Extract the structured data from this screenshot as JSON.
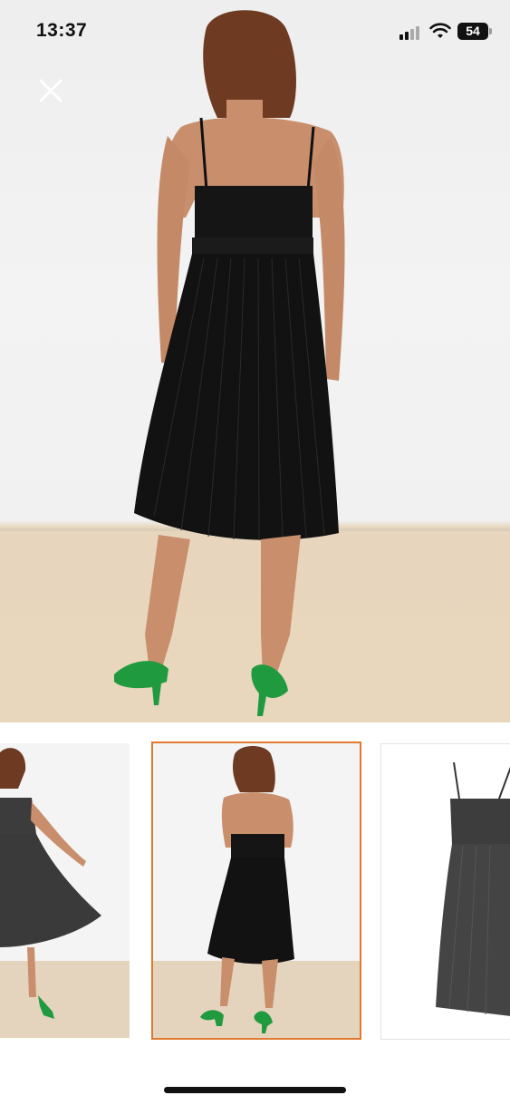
{
  "status_bar": {
    "time": "13:37",
    "battery": "54"
  },
  "gallery": {
    "thumbnail_count": 3,
    "selected_index": 1,
    "selected_border_color": "#e07a30"
  },
  "icons": {
    "close": "close-icon",
    "signal": "cellular-signal-icon",
    "wifi": "wifi-icon",
    "battery": "battery-icon"
  }
}
